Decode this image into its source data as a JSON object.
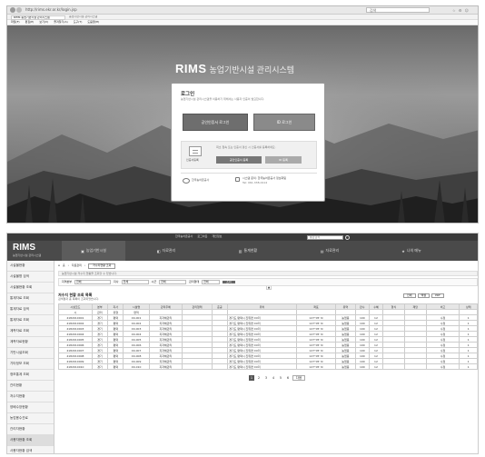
{
  "browser": {
    "address": "http://rims.ekr.or.kr/login.jsp",
    "search": "검색",
    "tabs": [
      "RIMS 농업기반시설 관리시스템",
      "농업기반시설 관리시스템"
    ],
    "menu": [
      "파일(F)",
      "편집(E)",
      "보기(V)",
      "즐겨찾기(A)",
      "도구(T)",
      "도움말(H)"
    ]
  },
  "login_screen": {
    "brand": "RIMS",
    "brand_sub": "농업기반시설 관리시스템",
    "box_title": "로그인",
    "box_desc": "농업기반시설 관리시스템을 이용하기 위해서는 사용자 인증이 필요합니다.",
    "cert_login_label": "공인인증서 로그인",
    "id_login_label": "ID 로그인",
    "cert_desc": "최초 접속 또는 인증서 갱신 시 인증서를 등록하세요.",
    "cert_title": "인증서등록",
    "cert_btn1": "공인인증서 등록",
    "cert_btn2": "ID 등록",
    "org_name": "한국농어촌공사",
    "contact_line1": "시스템 문의: 한국농어촌공사 정보화팀",
    "contact_line2": "Tel: 061-338-0114"
  },
  "app": {
    "topbar_items": [
      "한국농어촌공사",
      "로그아웃",
      "개인정보",
      "통합검색"
    ],
    "brand": "RIMS",
    "brand_sub": "농업기반시설 관리시스템",
    "nav": [
      "농업기반시설",
      "자료관리",
      "통계현황",
      "자료관리",
      "나의 메뉴"
    ],
    "sidebar": [
      "시설물현황",
      "시설물명 검색",
      "시설물현황 조회",
      "통계자료 조회",
      "통계자료 검색",
      "통계자료 조회",
      "계측자료 조회",
      "계측자료현황",
      "기반시설조회",
      "기타정보 조회",
      "정보통계 조회",
      "관리현황",
      "저수지현황",
      "양배수장현황",
      "농업용수관로",
      "관리자현황",
      "사용자현황 조회",
      "사용자현황 검색"
    ],
    "breadcrumb": [
      "홈",
      "자료관리",
      "저수지현황 조회"
    ],
    "tab_label": "저수지현황 조회",
    "info_text": "농업기반시설 저수지 현황을 조회할 수 있습니다.",
    "filters": {
      "f1_label": "지역본부",
      "f1_value": "전체",
      "f2_label": "지사",
      "f2_value": "전체",
      "f3_label": "시군",
      "f3_value": "전체",
      "f4_label": "관리형태",
      "f4_value": "전체",
      "search_btn": "조회"
    },
    "section_title": "저수지 현황 조회 목록",
    "section_note": "검색결과 총 목록이 조회되었습니다.",
    "action_buttons": [
      "인쇄",
      "엑셀",
      "PDF"
    ],
    "table": {
      "headers": [
        "시설코드",
        "본부",
        "지사",
        "시설명",
        "관리주체",
        "관리형태",
        "준공",
        "위치",
        "좌표",
        "유역",
        "만수",
        "수혜",
        "형식",
        "제당",
        "비고",
        "상태"
      ],
      "sub_row": [
        "시",
        "관리",
        "유형",
        "면적"
      ],
      "rows": [
        [
          "4182010001",
          "경기",
          "평택",
          "XX-001",
          "지자체관리",
          "",
          "",
          "경기도 평택시 진위면 XX리",
          "127°05' N",
          "농업용",
          "100",
          "12",
          "",
          "",
          "수정",
          "1"
        ],
        [
          "4182010002",
          "경기",
          "평택",
          "XX-002",
          "지자체관리",
          "",
          "",
          "경기도 평택시 진위면 XX리",
          "127°05' N",
          "농업용",
          "100",
          "12",
          "",
          "",
          "수정",
          "1"
        ],
        [
          "4182010003",
          "경기",
          "평택",
          "XX-003",
          "지자체관리",
          "",
          "",
          "경기도 평택시 진위면 XX리",
          "127°05' N",
          "농업용",
          "100",
          "12",
          "",
          "",
          "수정",
          "1"
        ],
        [
          "4182010004",
          "경기",
          "평택",
          "XX-004",
          "지자체관리",
          "",
          "",
          "경기도 평택시 진위면 XX리",
          "127°05' N",
          "농업용",
          "100",
          "12",
          "",
          "",
          "수정",
          "1"
        ],
        [
          "4182010005",
          "경기",
          "평택",
          "XX-005",
          "지자체관리",
          "",
          "",
          "경기도 평택시 진위면 XX리",
          "127°05' N",
          "농업용",
          "100",
          "12",
          "",
          "",
          "수정",
          "1"
        ],
        [
          "4182010006",
          "경기",
          "평택",
          "XX-006",
          "지자체관리",
          "",
          "",
          "경기도 평택시 진위면 XX리",
          "127°05' N",
          "농업용",
          "100",
          "12",
          "",
          "",
          "수정",
          "1"
        ],
        [
          "4182010007",
          "경기",
          "평택",
          "XX-007",
          "지자체관리",
          "",
          "",
          "경기도 평택시 진위면 XX리",
          "127°05' N",
          "농업용",
          "100",
          "12",
          "",
          "",
          "수정",
          "1"
        ],
        [
          "4182010008",
          "경기",
          "평택",
          "XX-008",
          "지자체관리",
          "",
          "",
          "경기도 평택시 진위면 XX리",
          "127°05' N",
          "농업용",
          "100",
          "12",
          "",
          "",
          "수정",
          "1"
        ],
        [
          "4182010009",
          "경기",
          "평택",
          "XX-009",
          "지자체관리",
          "",
          "",
          "경기도 평택시 진위면 XX리",
          "127°05' N",
          "농업용",
          "100",
          "12",
          "",
          "",
          "수정",
          "1"
        ],
        [
          "4182010010",
          "경기",
          "평택",
          "XX-010",
          "지자체관리",
          "",
          "",
          "경기도 평택시 진위면 XX리",
          "127°05' N",
          "농업용",
          "100",
          "12",
          "",
          "",
          "수정",
          "1"
        ]
      ]
    },
    "pagination": [
      "1",
      "2",
      "3",
      "4",
      "5",
      "6",
      "다음"
    ]
  }
}
